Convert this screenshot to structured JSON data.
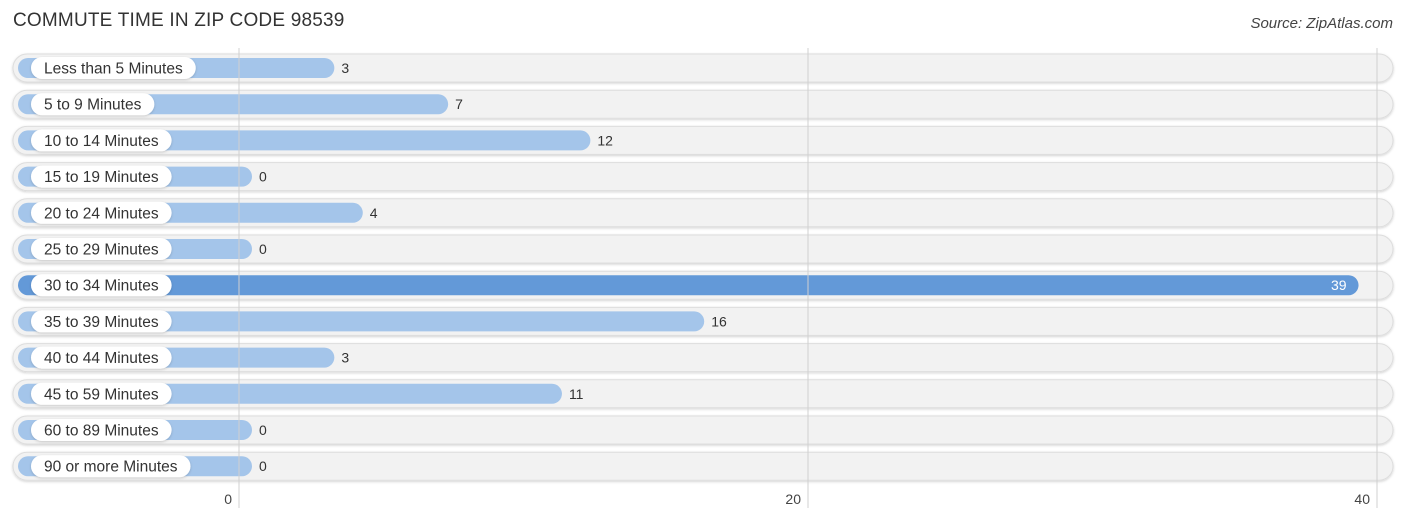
{
  "header": {
    "title": "COMMUTE TIME IN ZIP CODE 98539",
    "source": "Source: ZipAtlas.com"
  },
  "chart_data": {
    "type": "bar",
    "orientation": "horizontal",
    "title": "COMMUTE TIME IN ZIP CODE 98539",
    "xlabel": "",
    "ylabel": "",
    "xlim": [
      0,
      40
    ],
    "x_ticks": [
      0,
      20,
      40
    ],
    "x_tick_labels": [
      "0",
      "20",
      "40"
    ],
    "grid": true,
    "categories": [
      "Less than 5 Minutes",
      "5 to 9 Minutes",
      "10 to 14 Minutes",
      "15 to 19 Minutes",
      "20 to 24 Minutes",
      "25 to 29 Minutes",
      "30 to 34 Minutes",
      "35 to 39 Minutes",
      "40 to 44 Minutes",
      "45 to 59 Minutes",
      "60 to 89 Minutes",
      "90 or more Minutes"
    ],
    "values": [
      3,
      7,
      12,
      0,
      4,
      0,
      39,
      16,
      3,
      11,
      0,
      0
    ],
    "highlight_index": 6,
    "colors": {
      "bar": "#a4c5ea",
      "bar_highlight": "#6399d8",
      "track": "#f2f2f2",
      "track_border": "#dddddd",
      "label_bg": "#ffffff",
      "grid": "#d0d0d0"
    }
  }
}
